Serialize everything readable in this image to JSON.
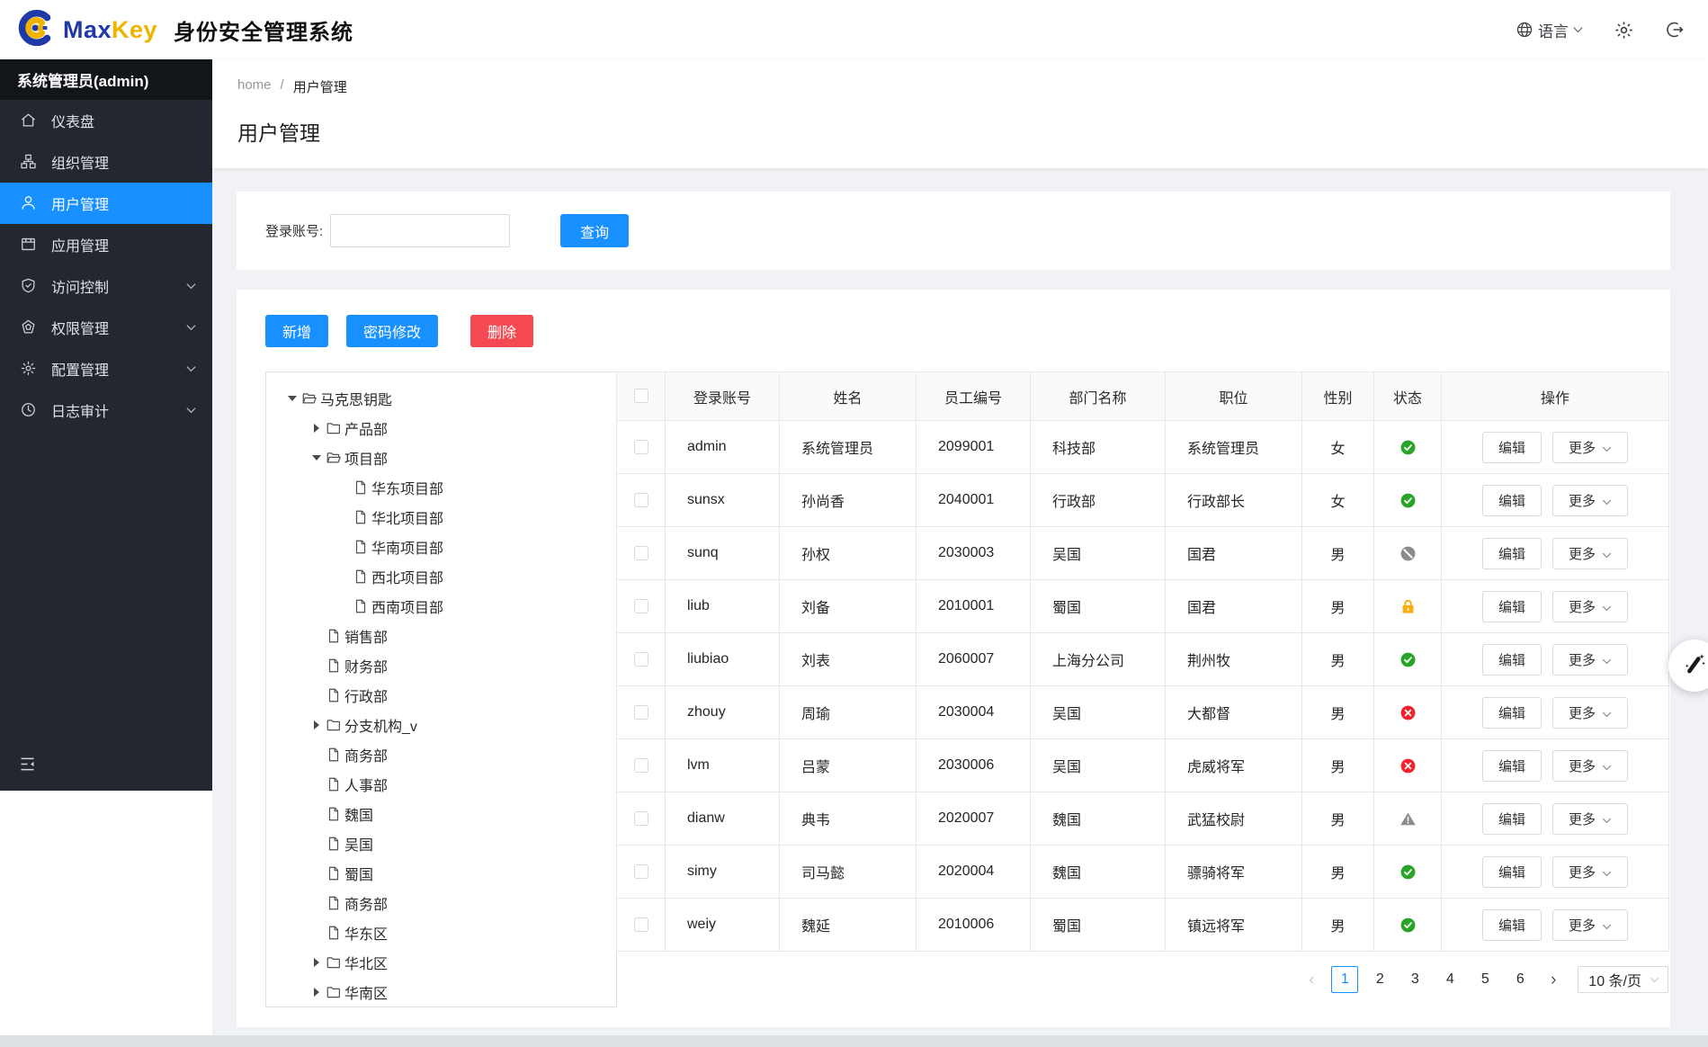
{
  "palette": {
    "primary": "#1890ff",
    "danger": "#f44952",
    "sidebar_bg": "#232830",
    "green": "#28a428",
    "red": "#f5222d",
    "orange": "#faad14",
    "gray": "#8c8c8c",
    "page_bg": "#f0f2f5"
  },
  "header": {
    "brand_max": "Max",
    "brand_key": "Key",
    "brand_suffix": "身份安全管理系统",
    "language_label": "语言"
  },
  "sidebar": {
    "user": "系统管理员(admin)",
    "items": [
      {
        "label": "仪表盘",
        "icon": "dashboard-icon",
        "active": false,
        "expandable": false
      },
      {
        "label": "组织管理",
        "icon": "org-icon",
        "active": false,
        "expandable": false
      },
      {
        "label": "用户管理",
        "icon": "user-icon",
        "active": true,
        "expandable": false
      },
      {
        "label": "应用管理",
        "icon": "app-icon",
        "active": false,
        "expandable": false
      },
      {
        "label": "访问控制",
        "icon": "access-control-icon",
        "active": false,
        "expandable": true
      },
      {
        "label": "权限管理",
        "icon": "permission-icon",
        "active": false,
        "expandable": true
      },
      {
        "label": "配置管理",
        "icon": "config-icon",
        "active": false,
        "expandable": true
      },
      {
        "label": "日志审计",
        "icon": "audit-log-icon",
        "active": false,
        "expandable": true
      }
    ]
  },
  "breadcrumb": {
    "home": "home",
    "separator": "/",
    "current": "用户管理"
  },
  "page": {
    "title": "用户管理"
  },
  "search": {
    "label": "登录账号:",
    "value": "",
    "button": "查询"
  },
  "toolbar": {
    "add": "新增",
    "change_password": "密码修改",
    "delete": "删除"
  },
  "tree": {
    "nodes": [
      {
        "label": "马克思钥匙",
        "level": 0,
        "type": "folder-open",
        "caret": "down"
      },
      {
        "label": "产品部",
        "level": 1,
        "type": "folder-closed",
        "caret": "right"
      },
      {
        "label": "项目部",
        "level": 1,
        "type": "folder-open",
        "caret": "down"
      },
      {
        "label": "华东项目部",
        "level": 2,
        "type": "file",
        "caret": "none"
      },
      {
        "label": "华北项目部",
        "level": 2,
        "type": "file",
        "caret": "none"
      },
      {
        "label": "华南项目部",
        "level": 2,
        "type": "file",
        "caret": "none"
      },
      {
        "label": "西北项目部",
        "level": 2,
        "type": "file",
        "caret": "none"
      },
      {
        "label": "西南项目部",
        "level": 2,
        "type": "file",
        "caret": "none"
      },
      {
        "label": "销售部",
        "level": 1,
        "type": "file",
        "caret": "none"
      },
      {
        "label": "财务部",
        "level": 1,
        "type": "file",
        "caret": "none"
      },
      {
        "label": "行政部",
        "level": 1,
        "type": "file",
        "caret": "none"
      },
      {
        "label": "分支机构_v",
        "level": 1,
        "type": "folder-closed",
        "caret": "right"
      },
      {
        "label": "商务部",
        "level": 1,
        "type": "file",
        "caret": "none"
      },
      {
        "label": "人事部",
        "level": 1,
        "type": "file",
        "caret": "none"
      },
      {
        "label": "魏国",
        "level": 1,
        "type": "file",
        "caret": "none"
      },
      {
        "label": "吴国",
        "level": 1,
        "type": "file",
        "caret": "none"
      },
      {
        "label": "蜀国",
        "level": 1,
        "type": "file",
        "caret": "none"
      },
      {
        "label": "商务部",
        "level": 1,
        "type": "file",
        "caret": "none"
      },
      {
        "label": "华东区",
        "level": 1,
        "type": "file",
        "caret": "none"
      },
      {
        "label": "华北区",
        "level": 1,
        "type": "folder-closed",
        "caret": "right"
      },
      {
        "label": "华南区",
        "level": 1,
        "type": "folder-closed",
        "caret": "right"
      }
    ]
  },
  "table": {
    "columns": [
      "登录账号",
      "姓名",
      "员工编号",
      "部门名称",
      "职位",
      "性别",
      "状态",
      "操作"
    ],
    "edit_label": "编辑",
    "more_label": "更多",
    "rows": [
      {
        "account": "admin",
        "name": "系统管理员",
        "employee_no": "2099001",
        "department": "科技部",
        "position": "系统管理员",
        "gender": "女",
        "status": "active"
      },
      {
        "account": "sunsx",
        "name": "孙尚香",
        "employee_no": "2040001",
        "department": "行政部",
        "position": "行政部长",
        "gender": "女",
        "status": "active"
      },
      {
        "account": "sunq",
        "name": "孙权",
        "employee_no": "2030003",
        "department": "吴国",
        "position": "国君",
        "gender": "男",
        "status": "disabled"
      },
      {
        "account": "liub",
        "name": "刘备",
        "employee_no": "2010001",
        "department": "蜀国",
        "position": "国君",
        "gender": "男",
        "status": "locked"
      },
      {
        "account": "liubiao",
        "name": "刘表",
        "employee_no": "2060007",
        "department": "上海分公司",
        "position": "荆州牧",
        "gender": "男",
        "status": "active"
      },
      {
        "account": "zhouy",
        "name": "周瑜",
        "employee_no": "2030004",
        "department": "吴国",
        "position": "大都督",
        "gender": "男",
        "status": "error"
      },
      {
        "account": "lvm",
        "name": "吕蒙",
        "employee_no": "2030006",
        "department": "吴国",
        "position": "虎威将军",
        "gender": "男",
        "status": "error"
      },
      {
        "account": "dianw",
        "name": "典韦",
        "employee_no": "2020007",
        "department": "魏国",
        "position": "武猛校尉",
        "gender": "男",
        "status": "warning"
      },
      {
        "account": "simy",
        "name": "司马懿",
        "employee_no": "2020004",
        "department": "魏国",
        "position": "骠骑将军",
        "gender": "男",
        "status": "active"
      },
      {
        "account": "weiy",
        "name": "魏延",
        "employee_no": "2010006",
        "department": "蜀国",
        "position": "镇远将军",
        "gender": "男",
        "status": "active"
      }
    ]
  },
  "pagination": {
    "pages": [
      "1",
      "2",
      "3",
      "4",
      "5",
      "6"
    ],
    "active": "1",
    "page_size": "10 条/页"
  }
}
